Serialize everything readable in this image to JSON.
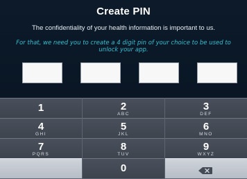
{
  "header": {
    "title": "Create PIN"
  },
  "message": {
    "confidentiality": "The confidentiality of your health information is important to us.",
    "instruction": "For that, we need you to create a 4 digit pin of your choice to be used to unlock your app."
  },
  "pin_fields": [
    {
      "value": ""
    },
    {
      "value": ""
    },
    {
      "value": ""
    },
    {
      "value": ""
    }
  ],
  "keypad": {
    "keys": [
      {
        "digit": "1",
        "letters": ""
      },
      {
        "digit": "2",
        "letters": "ABC"
      },
      {
        "digit": "3",
        "letters": "DEF"
      },
      {
        "digit": "4",
        "letters": "GHI"
      },
      {
        "digit": "5",
        "letters": "JKL"
      },
      {
        "digit": "6",
        "letters": "MNO"
      },
      {
        "digit": "7",
        "letters": "PQRS"
      },
      {
        "digit": "8",
        "letters": "TUV"
      },
      {
        "digit": "9",
        "letters": "WXYZ"
      },
      {
        "digit": "",
        "letters": ""
      },
      {
        "digit": "0",
        "letters": ""
      },
      {
        "icon": "backspace-icon"
      }
    ]
  },
  "colors": {
    "background": "#0b1522",
    "instruction_text": "#35bfd0",
    "keypad_key": "#444a54",
    "keypad_key_light": "#c3c8d0"
  }
}
